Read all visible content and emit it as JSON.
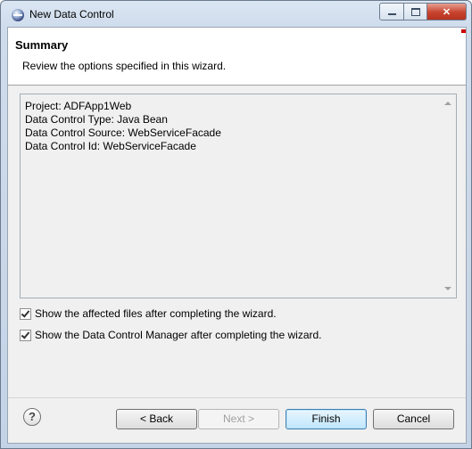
{
  "window": {
    "title": "New Data Control"
  },
  "window_controls": {
    "minimize": "minimize",
    "maximize": "maximize",
    "close": "✕"
  },
  "header": {
    "title": "Summary",
    "description": "Review the options specified in this wizard."
  },
  "summary_lines": [
    "Project: ADFApp1Web",
    "Data Control Type: Java Bean",
    "Data Control Source: WebServiceFacade",
    "Data Control Id: WebServiceFacade"
  ],
  "options": [
    {
      "label": "Show the affected files after completing the wizard.",
      "checked": true
    },
    {
      "label": "Show the Data Control Manager after completing the wizard.",
      "checked": true
    }
  ],
  "buttons": {
    "help": "?",
    "back": "< Back",
    "next": "Next >",
    "finish": "Finish",
    "cancel": "Cancel"
  },
  "colors": {
    "accent": "#3c7fb1",
    "close": "#c7432e"
  }
}
